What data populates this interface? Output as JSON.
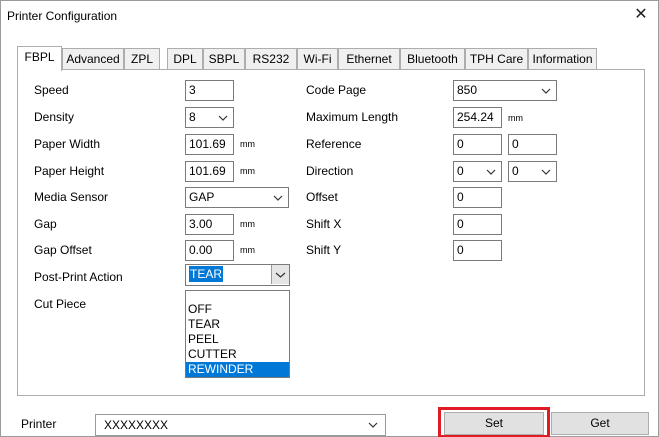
{
  "window": {
    "title": "Printer Configuration",
    "close_symbol": "✕"
  },
  "tabs": [
    {
      "label": "FBPL",
      "active": true
    },
    {
      "label": "Advanced",
      "active": false
    },
    {
      "label": "ZPL",
      "active": false
    },
    {
      "label": "DPL",
      "active": false
    },
    {
      "label": "SBPL",
      "active": false
    },
    {
      "label": "RS232",
      "active": false
    },
    {
      "label": "Wi-Fi",
      "active": false
    },
    {
      "label": "Ethernet",
      "active": false
    },
    {
      "label": "Bluetooth",
      "active": false
    },
    {
      "label": "TPH Care",
      "active": false
    },
    {
      "label": "Information",
      "active": false
    }
  ],
  "left": {
    "speed": {
      "label": "Speed",
      "value": "3"
    },
    "density": {
      "label": "Density",
      "value": "8"
    },
    "paper_width": {
      "label": "Paper Width",
      "value": "101.69",
      "unit": "mm"
    },
    "paper_height": {
      "label": "Paper Height",
      "value": "101.69",
      "unit": "mm"
    },
    "media_sensor": {
      "label": "Media Sensor",
      "value": "GAP"
    },
    "gap": {
      "label": "Gap",
      "value": "3.00",
      "unit": "mm"
    },
    "gap_offset": {
      "label": "Gap Offset",
      "value": "0.00",
      "unit": "mm"
    },
    "post_print_action": {
      "label": "Post-Print Action",
      "value": "TEAR"
    },
    "cut_piece": {
      "label": "Cut Piece"
    }
  },
  "right": {
    "code_page": {
      "label": "Code Page",
      "value": "850"
    },
    "maximum_length": {
      "label": "Maximum Length",
      "value": "254.24",
      "unit": "mm"
    },
    "reference": {
      "label": "Reference",
      "x": "0",
      "y": "0"
    },
    "direction": {
      "label": "Direction",
      "value1": "0",
      "value2": "0"
    },
    "offset": {
      "label": "Offset",
      "value": "0"
    },
    "shift_x": {
      "label": "Shift X",
      "value": "0"
    },
    "shift_y": {
      "label": "Shift Y",
      "value": "0"
    }
  },
  "dropdown_options": [
    "OFF",
    "TEAR",
    "PEEL",
    "CUTTER",
    "REWINDER"
  ],
  "dropdown_highlighted": "REWINDER",
  "bottom": {
    "printer_label": "Printer",
    "printer_value": "XXXXXXXX",
    "set_label": "Set",
    "get_label": "Get"
  },
  "colors": {
    "highlight": "#0078d7",
    "annotation_box": "#e01b24"
  }
}
